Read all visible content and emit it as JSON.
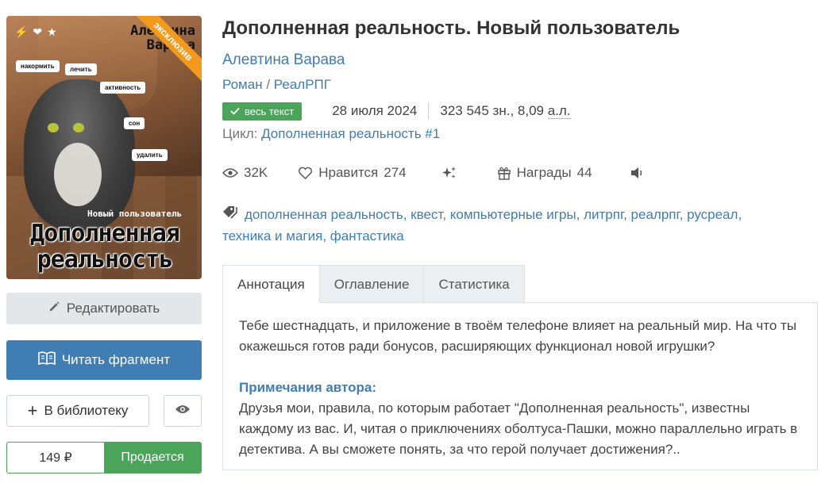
{
  "cover": {
    "author_line1": "Алевтина",
    "author_line2": "Варава",
    "ribbon": "эксклюзив",
    "labels": [
      "накормить",
      "лечить",
      "активность",
      "сон",
      "удалить"
    ],
    "subtitle": "Новый пользователь",
    "title_line1": "Дополненная",
    "title_line2": "реальность"
  },
  "actions": {
    "edit": "Редактировать",
    "read": "Читать фрагмент",
    "library": "В библиотеку",
    "price": "149 ₽",
    "sell": "Продается"
  },
  "book": {
    "title": "Дополненная реальность. Новый пользователь",
    "author": "Алевтина Варава",
    "genre1": "Роман",
    "genre_sep": "/",
    "genre2": "РеалРПГ",
    "badge": "весь текст",
    "date": "28 июля 2024",
    "size_prefix": "323 545 зн., 8,09 ",
    "size_unit": "а.л.",
    "cycle_label": "Цикл:",
    "cycle_name": "Дополненная реальность #1"
  },
  "stats": {
    "views": "32K",
    "likes_label": "Нравится",
    "likes": "274",
    "awards_label": "Награды",
    "awards": "44"
  },
  "tags": [
    "дополненная реальность",
    "квест",
    "компьютерные игры",
    "литрпг",
    "реалрпг",
    "русреал",
    "техника и магия",
    "фантастика"
  ],
  "tabs": [
    "Аннотация",
    "Оглавление",
    "Статистика"
  ],
  "annotation": {
    "text": "Тебе шестнадцать, и приложение в твоём телефоне влияет на реальный мир. На что ты окажешься готов ради бонусов, расширяющих функционал новой игрушки?",
    "notes_heading": "Примечания автора:",
    "notes_text": "Друзья мои, правила, по которым работает \"Дополненная реальность\", известны каждому из вас. И, читая о приключениях оболтуса-Пашки, можно параллельно играть в детектива. А вы сможете понять, за что герой получает достижения?.."
  },
  "colors": {
    "accent": "#3f7db3",
    "green": "#4aa55a",
    "ribbon": "#f39a1e"
  }
}
